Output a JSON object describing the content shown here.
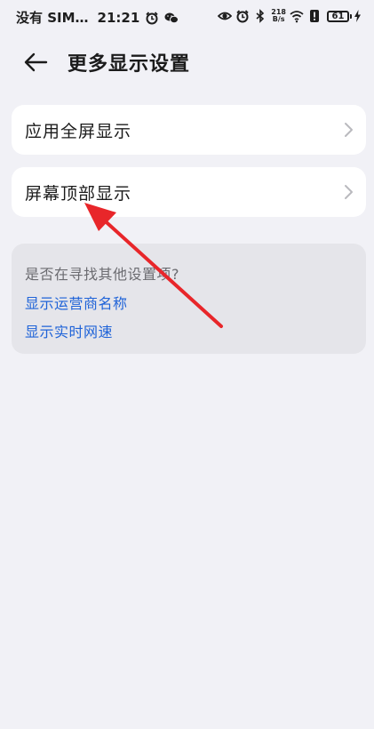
{
  "status_bar": {
    "carrier": "没有 SIM…",
    "time": "21:21",
    "net_speed_top": "218",
    "net_speed_bottom": "B/s",
    "battery": "61",
    "icons": [
      "alarm-icon",
      "wechat-icon",
      "eye-icon",
      "alarm-icon",
      "bluetooth-icon",
      "wifi-icon",
      "alert-icon",
      "charging-icon"
    ]
  },
  "header": {
    "title": "更多显示设置"
  },
  "items": [
    {
      "label": "应用全屏显示"
    },
    {
      "label": "屏幕顶部显示"
    }
  ],
  "suggestions": {
    "title": "是否在寻找其他设置项?",
    "links": [
      "显示运营商名称",
      "显示实时网速"
    ]
  },
  "colors": {
    "background": "#f1f1f6",
    "card": "#ffffff",
    "suggest_card": "#e5e5ea",
    "link": "#1f63d8",
    "annotation_arrow": "#e8262a"
  }
}
